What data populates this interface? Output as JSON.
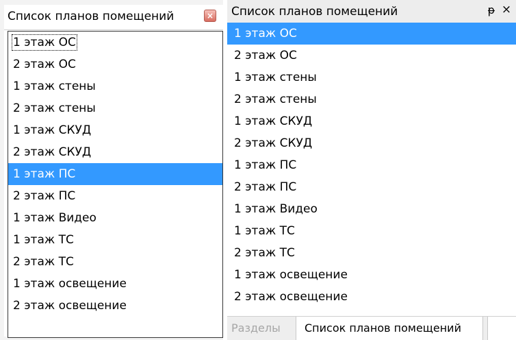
{
  "left_panel": {
    "title": "Список планов помещений",
    "close_symbol": "×",
    "items": [
      {
        "label": "1 этаж ОС",
        "focused": true,
        "selected": false
      },
      {
        "label": "2 этаж ОС",
        "focused": false,
        "selected": false
      },
      {
        "label": "1 этаж стены",
        "focused": false,
        "selected": false
      },
      {
        "label": "2 этаж стены",
        "focused": false,
        "selected": false
      },
      {
        "label": "1 этаж СКУД",
        "focused": false,
        "selected": false
      },
      {
        "label": "2 этаж СКУД",
        "focused": false,
        "selected": false
      },
      {
        "label": "1 этаж ПС",
        "focused": false,
        "selected": true
      },
      {
        "label": "2 этаж ПС",
        "focused": false,
        "selected": false
      },
      {
        "label": "1 этаж Видео",
        "focused": false,
        "selected": false
      },
      {
        "label": "1 этаж ТС",
        "focused": false,
        "selected": false
      },
      {
        "label": "2 этаж ТС",
        "focused": false,
        "selected": false
      },
      {
        "label": "1 этаж освещение",
        "focused": false,
        "selected": false
      },
      {
        "label": "2 этаж освещение",
        "focused": false,
        "selected": false
      }
    ]
  },
  "right_panel": {
    "title": "Список планов помещений",
    "pin_symbol": "ᵽ",
    "close_symbol": "×",
    "items": [
      {
        "label": "1 этаж ОС",
        "selected": true
      },
      {
        "label": "2 этаж ОС",
        "selected": false
      },
      {
        "label": "1 этаж стены",
        "selected": false
      },
      {
        "label": "2 этаж стены",
        "selected": false
      },
      {
        "label": "1 этаж СКУД",
        "selected": false
      },
      {
        "label": "2 этаж СКУД",
        "selected": false
      },
      {
        "label": "1 этаж ПС",
        "selected": false
      },
      {
        "label": "2 этаж ПС",
        "selected": false
      },
      {
        "label": "1 этаж Видео",
        "selected": false
      },
      {
        "label": "1 этаж ТС",
        "selected": false
      },
      {
        "label": "2 этаж ТС",
        "selected": false
      },
      {
        "label": "1 этаж освещение",
        "selected": false
      },
      {
        "label": "2 этаж освещение",
        "selected": false
      }
    ],
    "tabs": {
      "sections_label": "Разделы",
      "plans_label": "Список планов помещений"
    }
  },
  "colors": {
    "selection": "#3399ff",
    "selected_text": "#ffffff",
    "inactive_tab_text": "#a6a6a6"
  },
  "icons": {
    "left_close": "close-icon",
    "right_pin": "pin-icon",
    "right_close": "close-icon"
  }
}
